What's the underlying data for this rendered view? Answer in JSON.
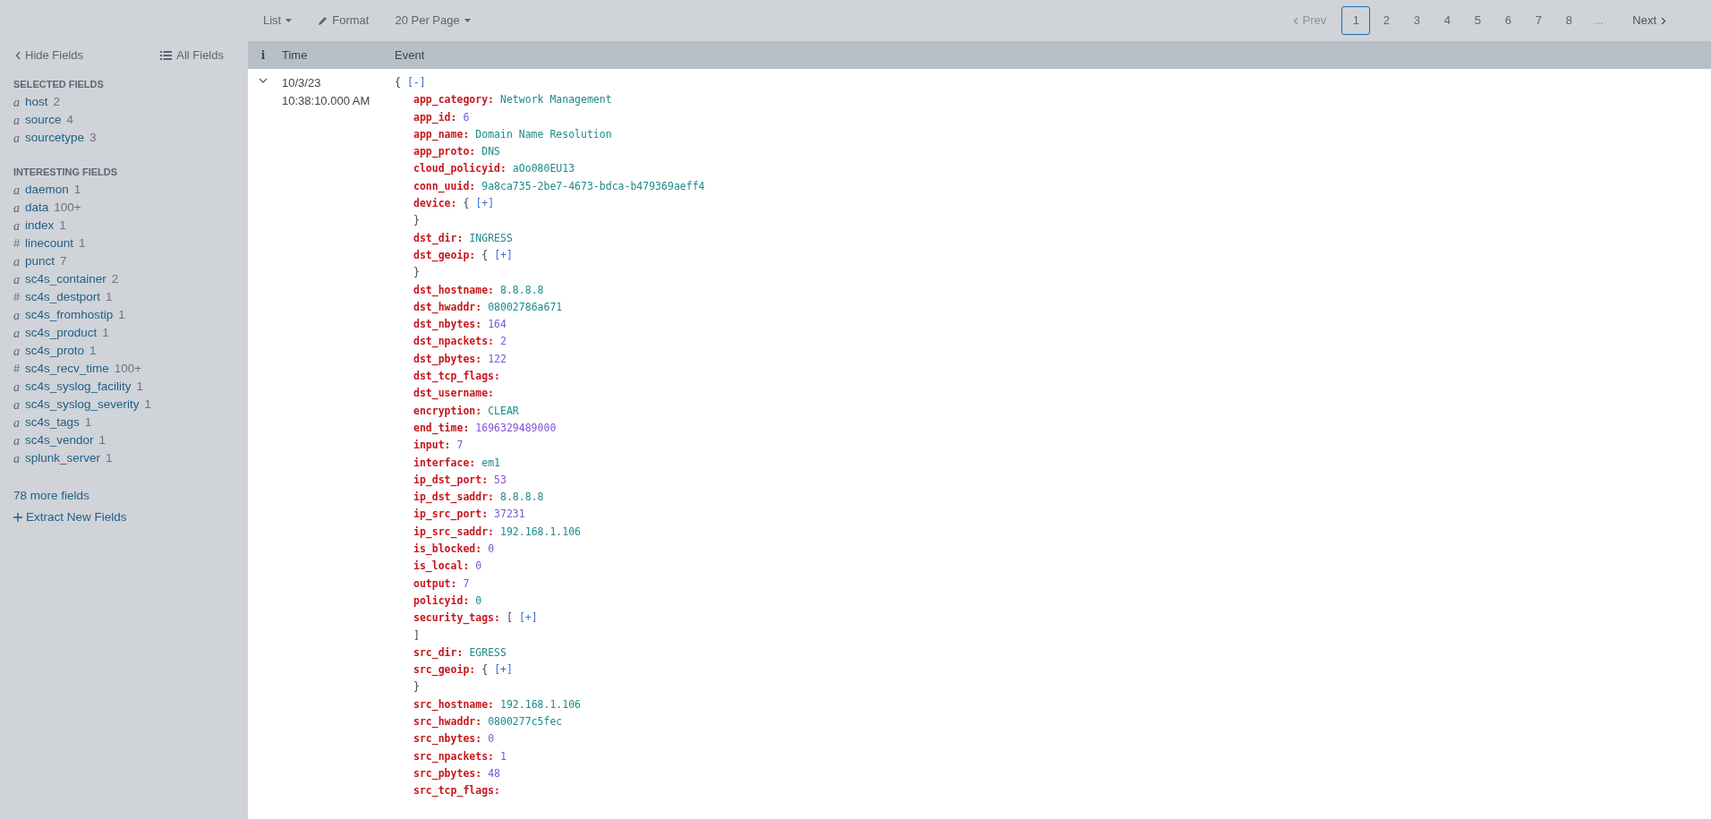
{
  "toolbar": {
    "items": [
      {
        "label": "List",
        "kind": "dropdown"
      },
      {
        "label": "Format",
        "kind": "edit"
      },
      {
        "label": "20 Per Page",
        "kind": "dropdown"
      }
    ]
  },
  "pagination": {
    "prev": {
      "label": "Prev",
      "disabled": true
    },
    "pages": [
      {
        "label": "1",
        "selected": true
      },
      {
        "label": "2",
        "selected": false
      },
      {
        "label": "3",
        "selected": false
      },
      {
        "label": "4",
        "selected": false
      },
      {
        "label": "5",
        "selected": false
      },
      {
        "label": "6",
        "selected": false
      },
      {
        "label": "7",
        "selected": false
      },
      {
        "label": "8",
        "selected": false
      }
    ],
    "ellipsis": "...",
    "next": {
      "label": "Next",
      "disabled": false
    }
  },
  "sidebar": {
    "hide_fields": "Hide Fields",
    "all_fields": "All Fields",
    "sections": [
      {
        "title": "SELECTED FIELDS",
        "fields": [
          {
            "type": "a",
            "name": "host",
            "count": "2"
          },
          {
            "type": "a",
            "name": "source",
            "count": "4"
          },
          {
            "type": "a",
            "name": "sourcetype",
            "count": "3"
          }
        ]
      },
      {
        "title": "INTERESTING FIELDS",
        "fields": [
          {
            "type": "a",
            "name": "daemon",
            "count": "1"
          },
          {
            "type": "a",
            "name": "data",
            "count": "100+"
          },
          {
            "type": "a",
            "name": "index",
            "count": "1"
          },
          {
            "type": "#",
            "name": "linecount",
            "count": "1"
          },
          {
            "type": "a",
            "name": "punct",
            "count": "7"
          },
          {
            "type": "a",
            "name": "sc4s_container",
            "count": "2"
          },
          {
            "type": "#",
            "name": "sc4s_destport",
            "count": "1"
          },
          {
            "type": "a",
            "name": "sc4s_fromhostip",
            "count": "1"
          },
          {
            "type": "a",
            "name": "sc4s_product",
            "count": "1"
          },
          {
            "type": "a",
            "name": "sc4s_proto",
            "count": "1"
          },
          {
            "type": "#",
            "name": "sc4s_recv_time",
            "count": "100+"
          },
          {
            "type": "a",
            "name": "sc4s_syslog_facility",
            "count": "1"
          },
          {
            "type": "a",
            "name": "sc4s_syslog_severity",
            "count": "1"
          },
          {
            "type": "a",
            "name": "sc4s_tags",
            "count": "1"
          },
          {
            "type": "a",
            "name": "sc4s_vendor",
            "count": "1"
          },
          {
            "type": "a",
            "name": "splunk_server",
            "count": "1"
          }
        ]
      }
    ],
    "more_fields": "78 more fields",
    "extract": "Extract New Fields"
  },
  "table": {
    "columns": [
      "i",
      "Time",
      "Event"
    ],
    "event": {
      "expanded": true,
      "date": "10/3/23",
      "time": "10:38:10.000 AM",
      "lines": [
        {
          "kind": "open",
          "bracket": "{",
          "toggle": "[-]"
        },
        {
          "kind": "field",
          "key": "app_category:",
          "value": "Network Management",
          "color": "#1e8a8a"
        },
        {
          "kind": "field",
          "key": "app_id:",
          "value": "6",
          "color": "#7b54d8"
        },
        {
          "kind": "field",
          "key": "app_name:",
          "value": "Domain Name Resolution",
          "color": "#1e8a8a"
        },
        {
          "kind": "field",
          "key": "app_proto:",
          "value": "DNS",
          "color": "#1e8a8a"
        },
        {
          "kind": "field",
          "key": "cloud_policyid:",
          "value": "aOo080EU13",
          "color": "#1e8a8a"
        },
        {
          "kind": "field",
          "key": "conn_uuid:",
          "value": "9a8ca735-2be7-4673-bdca-b479369aeff4",
          "color": "#1e8a8a"
        },
        {
          "kind": "nested",
          "key": "device:",
          "bracket": "{",
          "toggle": "[+]"
        },
        {
          "kind": "close",
          "bracket": "}"
        },
        {
          "kind": "field",
          "key": "dst_dir:",
          "value": "INGRESS",
          "color": "#1e8a8a"
        },
        {
          "kind": "nested",
          "key": "dst_geoip:",
          "bracket": "{",
          "toggle": "[+]"
        },
        {
          "kind": "close",
          "bracket": "}"
        },
        {
          "kind": "field",
          "key": "dst_hostname:",
          "value": "8.8.8.8",
          "color": "#1e8a8a"
        },
        {
          "kind": "field",
          "key": "dst_hwaddr:",
          "value": "08002786a671",
          "color": "#1e8a8a"
        },
        {
          "kind": "field",
          "key": "dst_nbytes:",
          "value": "164",
          "color": "#7b54d8"
        },
        {
          "kind": "field",
          "key": "dst_npackets:",
          "value": "2",
          "color": "#7b54d8"
        },
        {
          "kind": "field",
          "key": "dst_pbytes:",
          "value": "122",
          "color": "#7b54d8"
        },
        {
          "kind": "field",
          "key": "dst_tcp_flags:"
        },
        {
          "kind": "field",
          "key": "dst_username:"
        },
        {
          "kind": "field",
          "key": "encryption:",
          "value": "CLEAR",
          "color": "#1e8a8a"
        },
        {
          "kind": "field",
          "key": "end_time:",
          "value": "1696329489000",
          "color": "#7b54d8"
        },
        {
          "kind": "field",
          "key": "input:",
          "value": "7",
          "color": "#7b54d8"
        },
        {
          "kind": "field",
          "key": "interface:",
          "value": "em1",
          "color": "#1e8a8a"
        },
        {
          "kind": "field",
          "key": "ip_dst_port:",
          "value": "53",
          "color": "#7b54d8"
        },
        {
          "kind": "field",
          "key": "ip_dst_saddr:",
          "value": "8.8.8.8",
          "color": "#1e8a8a"
        },
        {
          "kind": "field",
          "key": "ip_src_port:",
          "value": "37231",
          "color": "#7b54d8"
        },
        {
          "kind": "field",
          "key": "ip_src_saddr:",
          "value": "192.168.1.106",
          "color": "#1e8a8a"
        },
        {
          "kind": "field",
          "key": "is_blocked:",
          "value": "0",
          "color": "#7b54d8"
        },
        {
          "kind": "field",
          "key": "is_local:",
          "value": "0",
          "color": "#7b54d8"
        },
        {
          "kind": "field",
          "key": "output:",
          "value": "7",
          "color": "#7b54d8"
        },
        {
          "kind": "field",
          "key": "policyid:",
          "value": "0",
          "color": "#1e8a8a"
        },
        {
          "kind": "nested",
          "key": "security_tags:",
          "bracket": "[",
          "toggle": "[+]"
        },
        {
          "kind": "close",
          "bracket": "]"
        },
        {
          "kind": "field",
          "key": "src_dir:",
          "value": "EGRESS",
          "color": "#1e8a8a"
        },
        {
          "kind": "nested",
          "key": "src_geoip:",
          "bracket": "{",
          "toggle": "[+]"
        },
        {
          "kind": "close",
          "bracket": "}"
        },
        {
          "kind": "field",
          "key": "src_hostname:",
          "value": "192.168.1.106",
          "color": "#1e8a8a"
        },
        {
          "kind": "field",
          "key": "src_hwaddr:",
          "value": "0800277c5fec",
          "color": "#1e8a8a"
        },
        {
          "kind": "field",
          "key": "src_nbytes:",
          "value": "0",
          "color": "#7b54d8"
        },
        {
          "kind": "field",
          "key": "src_npackets:",
          "value": "1",
          "color": "#7b54d8"
        },
        {
          "kind": "field",
          "key": "src_pbytes:",
          "value": "48",
          "color": "#7b54d8"
        },
        {
          "kind": "field",
          "key": "src_tcp_flags:"
        }
      ]
    }
  }
}
